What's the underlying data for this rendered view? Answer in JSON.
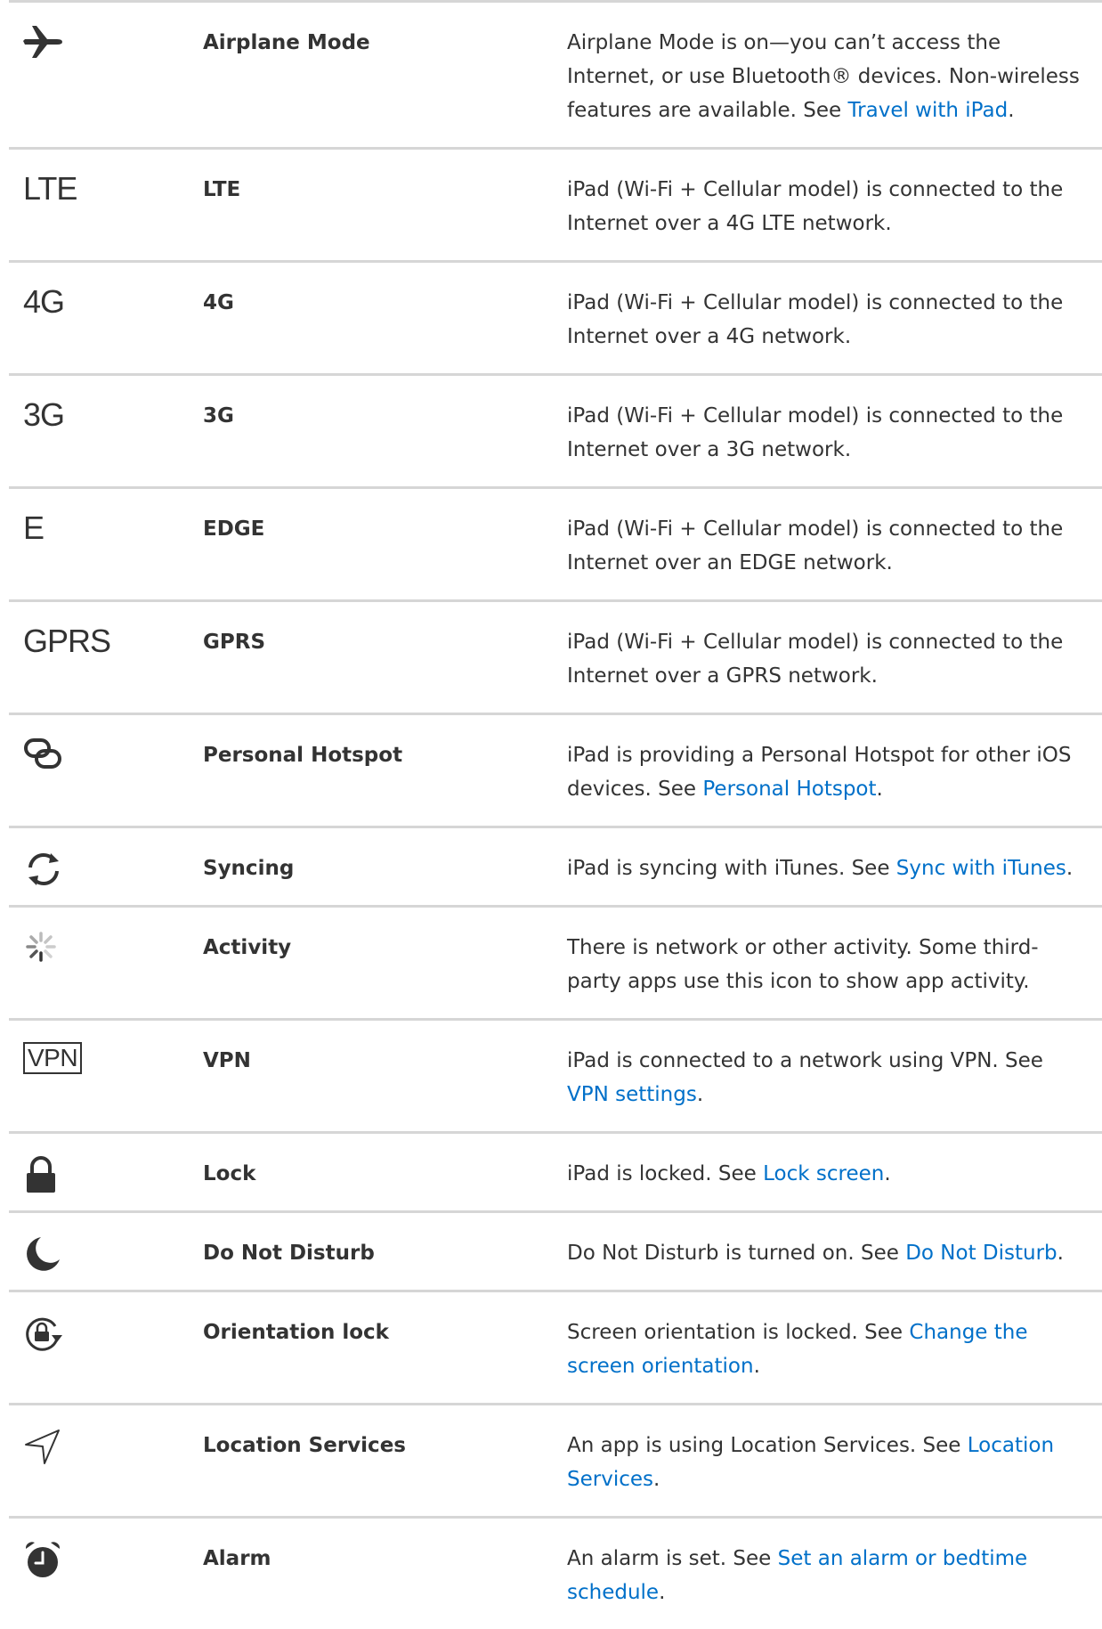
{
  "colors": {
    "text": "#333333",
    "link": "#0070c9",
    "divider": "#d6d6d6"
  },
  "rows": [
    {
      "icon": "airplane-icon",
      "name": "Airplane Mode",
      "desc": "Airplane Mode is on—you can’t access the Internet, or use Bluetooth® devices. Non-wireless features are available. See ",
      "link": "Travel with iPad",
      "after": "."
    },
    {
      "icon_text": "LTE",
      "name": "LTE",
      "desc": "iPad (Wi-Fi + Cellular model) is connected to the Internet over a 4G LTE network."
    },
    {
      "icon_text": "4G",
      "name": "4G",
      "desc": "iPad (Wi-Fi + Cellular model) is connected to the Internet over a 4G network."
    },
    {
      "icon_text": "3G",
      "name": "3G",
      "desc": "iPad (Wi-Fi + Cellular model) is connected to the Internet over a 3G network."
    },
    {
      "icon_text": "E",
      "name": "EDGE",
      "desc": "iPad (Wi-Fi + Cellular model) is connected to the Internet over an EDGE network."
    },
    {
      "icon_text": "GPRS",
      "name": "GPRS",
      "desc": "iPad (Wi-Fi + Cellular model) is connected to the Internet over a GPRS network."
    },
    {
      "icon": "personal-hotspot-icon",
      "name": "Personal Hotspot",
      "desc": "iPad is providing a Personal Hotspot for other iOS devices. See ",
      "link": "Personal Hotspot",
      "after": "."
    },
    {
      "icon": "syncing-icon",
      "name": "Syncing",
      "desc": "iPad is syncing with iTunes. See ",
      "link": "Sync with iTunes",
      "after": "."
    },
    {
      "icon": "activity-spinner-icon",
      "name": "Activity",
      "desc": "There is network or other activity. Some third-party apps use this icon to show app activity."
    },
    {
      "icon_text": "VPN",
      "name": "VPN",
      "desc": "iPad is connected to a network using VPN. See ",
      "link": "VPN settings",
      "after": "."
    },
    {
      "icon": "lock-icon",
      "name": "Lock",
      "desc": "iPad is locked. See ",
      "link": "Lock screen",
      "after": "."
    },
    {
      "icon": "moon-icon",
      "name": "Do Not Disturb",
      "desc": "Do Not Disturb is turned on. See ",
      "link": "Do Not Disturb",
      "after": "."
    },
    {
      "icon": "orientation-lock-icon",
      "name": "Orientation lock",
      "desc": "Screen orientation is locked. See ",
      "link": "Change the screen orientation",
      "after": "."
    },
    {
      "icon": "location-arrow-icon",
      "name": "Location Services",
      "desc": "An app is using Location Services. See ",
      "link": "Location Services",
      "after": "."
    },
    {
      "icon": "alarm-clock-icon",
      "name": "Alarm",
      "desc": "An alarm is set. See ",
      "link": "Set an alarm or bedtime schedule",
      "after": "."
    }
  ]
}
